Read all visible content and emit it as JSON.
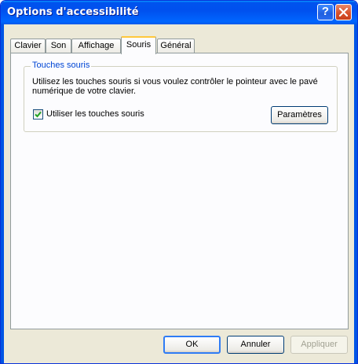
{
  "window": {
    "title": "Options d'accessibilité"
  },
  "titlebar": {
    "help_label": "?"
  },
  "tabs": [
    {
      "label": "Clavier"
    },
    {
      "label": "Son"
    },
    {
      "label": "Affichage"
    },
    {
      "label": "Souris",
      "active": true
    },
    {
      "label": "Général"
    }
  ],
  "group": {
    "title": "Touches souris",
    "description": "Utilisez les touches souris si vous voulez contrôler le pointeur avec le pavé numérique de votre clavier.",
    "checkbox_label": "Utiliser les touches souris",
    "checkbox_checked": true,
    "settings_button": "Paramètres"
  },
  "footer": {
    "ok": "OK",
    "cancel": "Annuler",
    "apply": "Appliquer"
  },
  "colors": {
    "titlebar": "#0054e3",
    "tab_highlight": "#ffc83c",
    "group_title": "#0046d5"
  },
  "icons": {
    "help": "help-icon",
    "close": "close-icon",
    "check": "checkmark-icon"
  }
}
